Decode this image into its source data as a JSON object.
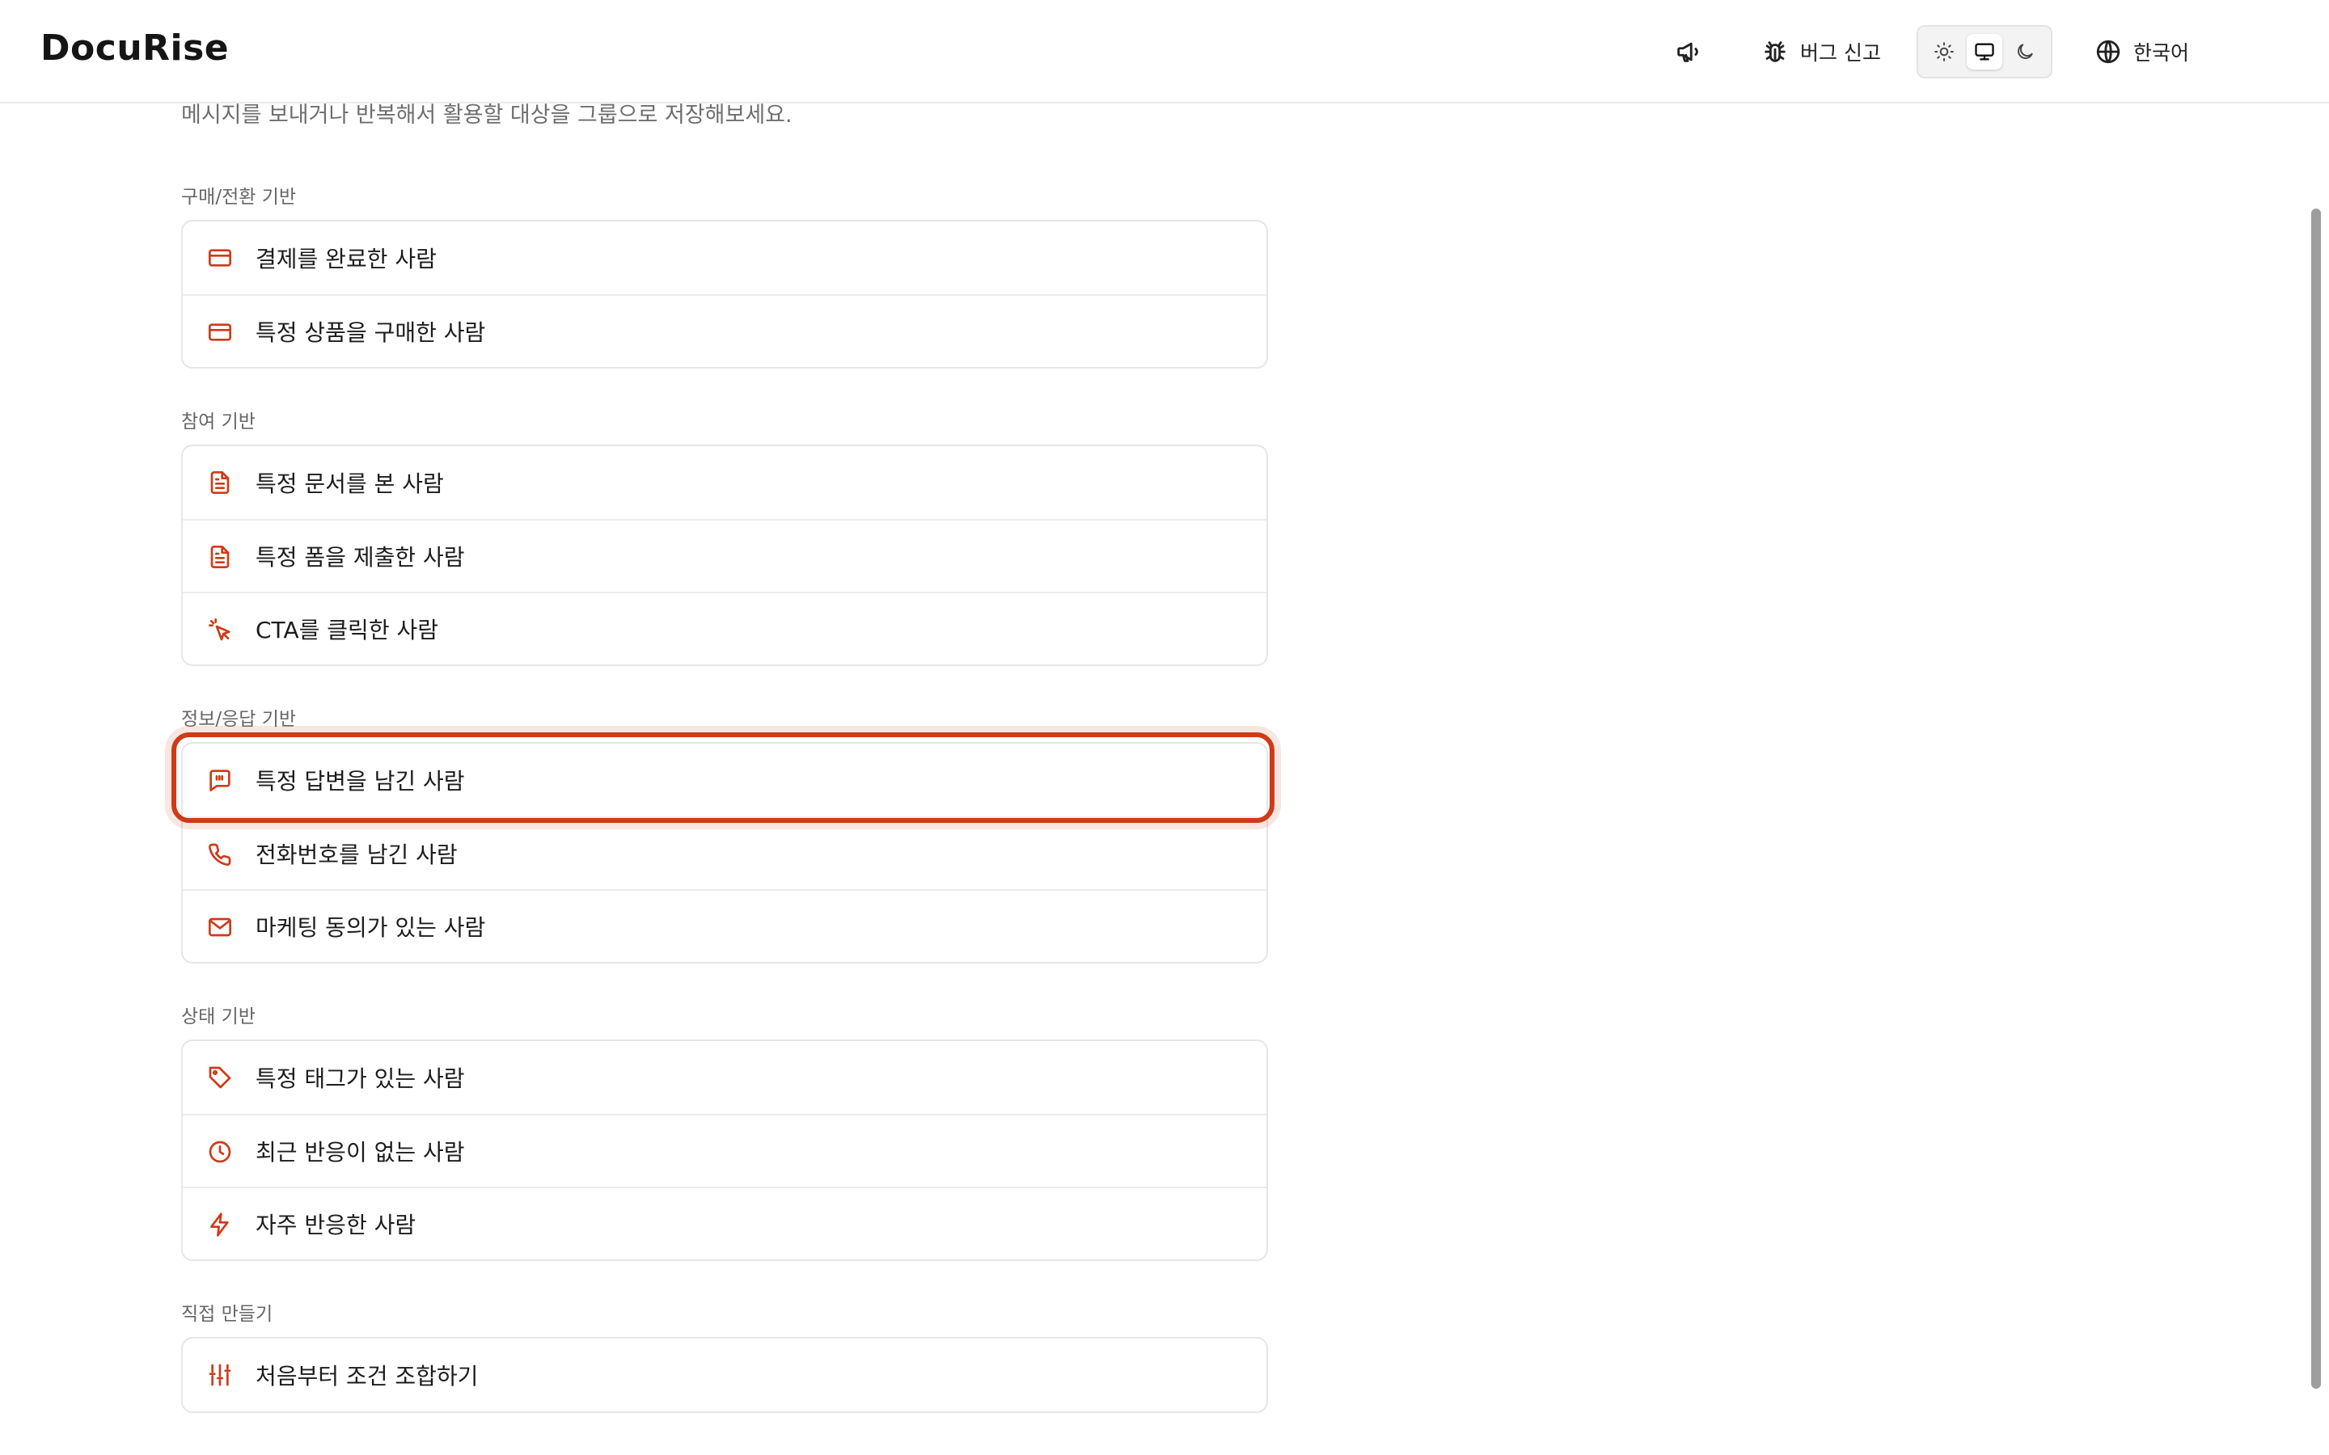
{
  "app": {
    "logo": "DocuRise"
  },
  "header": {
    "announce_icon": "megaphone-icon",
    "bug_report_label": "버그 신고",
    "theme_options": [
      "sun-icon",
      "monitor-icon",
      "moon-icon"
    ],
    "theme_selected": "system",
    "language_label": "한국어"
  },
  "page": {
    "subtitle": "메시지를 보내거나 반복해서 활용할 대상을 그룹으로 저장해보세요."
  },
  "sections": [
    {
      "title": "구매/전환 기반",
      "items": [
        {
          "label": "결제를 완료한 사람",
          "icon": "credit-card-icon"
        },
        {
          "label": "특정 상품을 구매한 사람",
          "icon": "credit-card-icon"
        }
      ]
    },
    {
      "title": "참여 기반",
      "items": [
        {
          "label": "특정 문서를 본 사람",
          "icon": "document-icon"
        },
        {
          "label": "특정 폼을 제출한 사람",
          "icon": "document-icon"
        },
        {
          "label": "CTA를 클릭한 사람",
          "icon": "cursor-click-icon"
        }
      ]
    },
    {
      "title": "정보/응답 기반",
      "items": [
        {
          "label": "특정 답변을 남긴 사람",
          "icon": "message-quote-icon"
        },
        {
          "label": "전화번호를 남긴 사람",
          "icon": "phone-icon"
        },
        {
          "label": "마케팅 동의가 있는 사람",
          "icon": "mail-icon"
        }
      ]
    },
    {
      "title": "상태 기반",
      "items": [
        {
          "label": "특정 태그가 있는 사람",
          "icon": "tag-icon"
        },
        {
          "label": "최근 반응이 없는 사람",
          "icon": "clock-icon"
        },
        {
          "label": "자주 반응한 사람",
          "icon": "lightning-icon"
        }
      ]
    },
    {
      "title": "직접 만들기",
      "items": [
        {
          "label": "처음부터 조건 조합하기",
          "icon": "sliders-icon"
        }
      ]
    }
  ],
  "colors": {
    "accent": "#cf3a17",
    "highlight_ring": "#cf3a17"
  }
}
